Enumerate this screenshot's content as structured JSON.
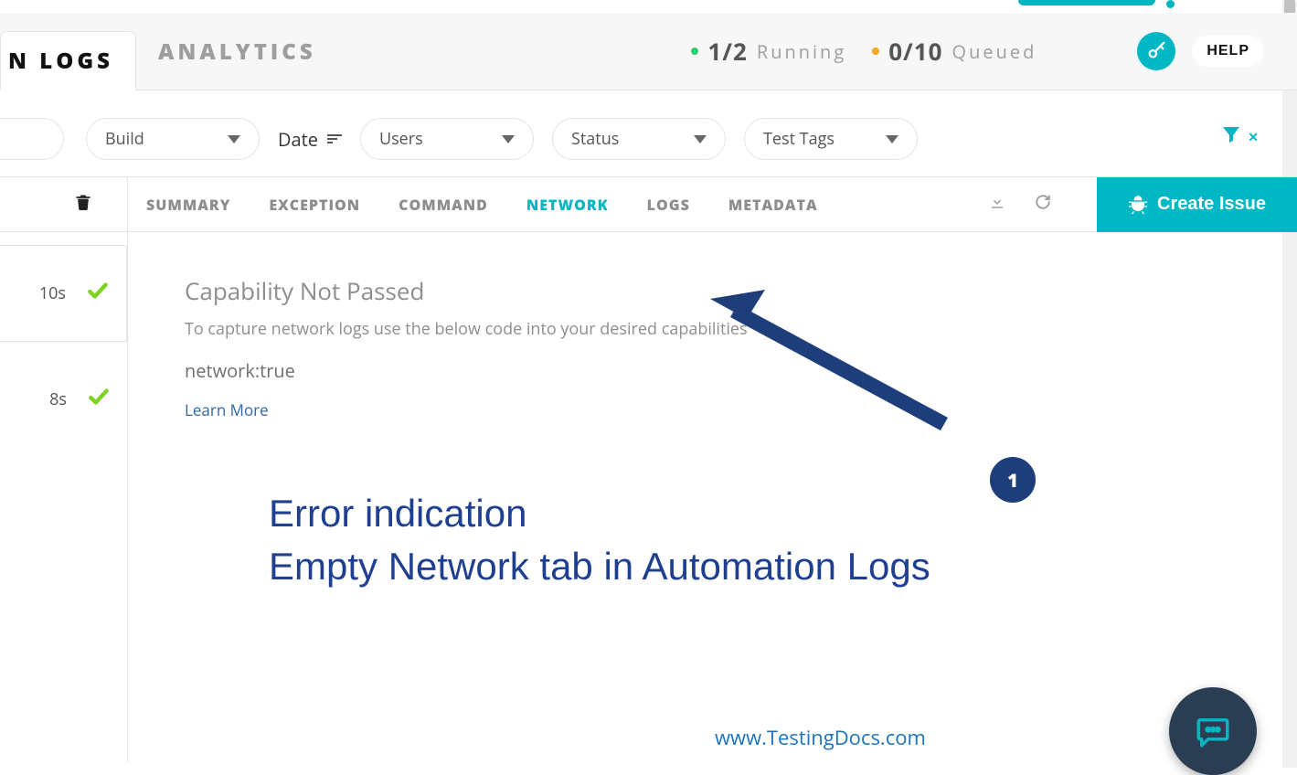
{
  "top_tabs": {
    "active_suffix": "N LOGS",
    "analytics": "ANALYTICS"
  },
  "stats": {
    "running_count": "1/2",
    "running_label": "Running",
    "queued_count": "0/10",
    "queued_label": "Queued"
  },
  "help_label": "HELP",
  "filters": {
    "build": "Build",
    "date": "Date",
    "users": "Users",
    "status": "Status",
    "test_tags": "Test Tags"
  },
  "detail_tabs": {
    "summary": "SUMMARY",
    "exception": "EXCEPTION",
    "command": "COMMAND",
    "network": "NETWORK",
    "logs": "LOGS",
    "metadata": "METADATA"
  },
  "create_issue": "Create Issue",
  "rows": {
    "r1_time": "10s",
    "r2_time": "8s"
  },
  "capability": {
    "title": "Capability Not Passed",
    "subtitle": "To capture network logs use the below code into your desired capabilities",
    "code": "network:true",
    "learn": "Learn More"
  },
  "annotation": {
    "marker": "1",
    "line1": "Error indication",
    "line2": "Empty Network tab in Automation Logs",
    "site": "www.TestingDocs.com"
  }
}
